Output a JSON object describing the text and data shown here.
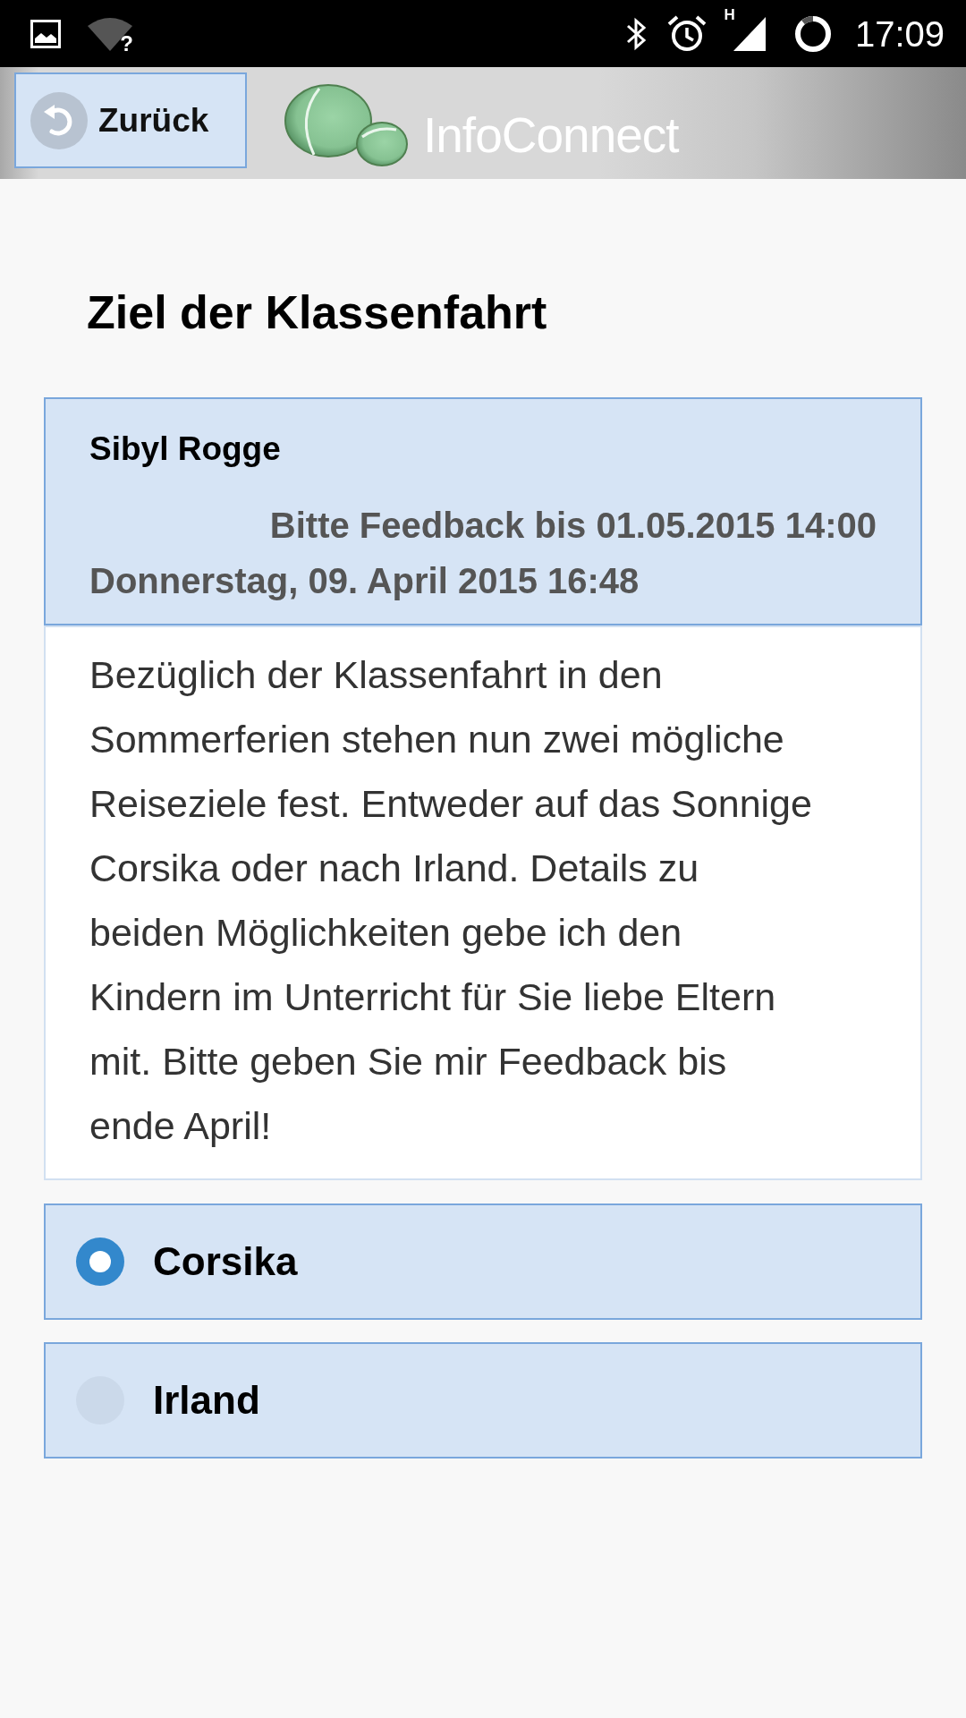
{
  "status_bar": {
    "wifi_badge": "?",
    "network_type": "H",
    "time": "17:09"
  },
  "header": {
    "back_button": "Zurück",
    "logo_text": "InfoConnect"
  },
  "title": "Ziel der Klassenfahrt",
  "message": {
    "author": "Sibyl Rogge",
    "deadline": "Bitte Feedback bis 01.05.2015 14:00",
    "date": "Donnerstag, 09. April 2015 16:48",
    "body": "Bezüglich der Klassenfahrt in den Sommerferien stehen nun zwei mögliche Reiseziele fest. Entweder auf das Sonnige Corsika oder nach Irland. Details zu beiden Möglichkeiten gebe ich den Kindern im Unterricht für Sie liebe Eltern mit. Bitte geben Sie mir Feedback bis ende April!"
  },
  "options": [
    {
      "label": "Corsika",
      "selected": true
    },
    {
      "label": "Irland",
      "selected": false
    }
  ]
}
